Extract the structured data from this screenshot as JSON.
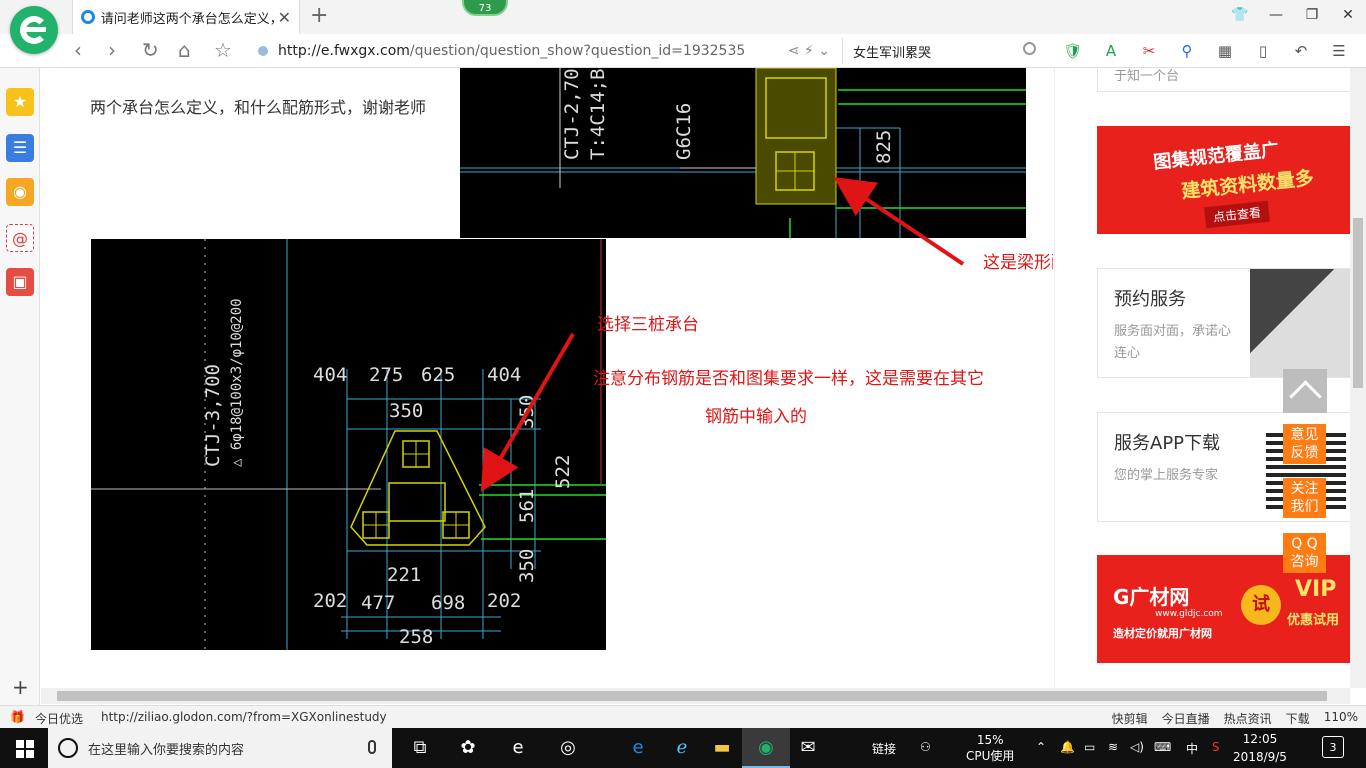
{
  "browser": {
    "tab_title": "请问老师这两个承台怎么定义，谢谢老师",
    "badge_count": "73",
    "url_host": "http://e.fwxgx.com",
    "url_path": "/question/question_show?question_id=1932535",
    "search_query": "女生军训累哭"
  },
  "question": {
    "text": "两个承台怎么定义，和什么配筋形式，谢谢老师"
  },
  "cad_top": {
    "label_ctj": "CTJ-2,70",
    "label_t": "T:4C14;B",
    "label_g": "G6C16",
    "dim_825": "825"
  },
  "cad_bottom": {
    "label_ctj": "CTJ-3,700",
    "label_rebar": "△ 6φ18@100x3/φ10@200",
    "dims": {
      "d404a": "404",
      "d275": "275",
      "d625": "625",
      "d404b": "404",
      "d350top": "350",
      "d350r": "350",
      "d522": "522",
      "d561": "561",
      "d350r2": "350",
      "d221": "221",
      "d202a": "202",
      "d477": "477",
      "d698": "698",
      "d202b": "202",
      "d258": "258"
    }
  },
  "annotations": {
    "beam": "这是梁形配筋承台",
    "three_pile": "选择三桩承台",
    "note_line1": "注意分布钢筋是否和图集要求一样，这是需要在其它",
    "note_line2": "钢筋中输入的"
  },
  "sidebar": {
    "top_partial": "于知一个台",
    "banner1": {
      "line1": "图集规范覆盖广",
      "line2": "建筑资料数量多",
      "button": "点击查看"
    },
    "card1": {
      "title": "预约服务",
      "sub": "服务面对面，承诺心连心"
    },
    "card2": {
      "title": "服务APP下载",
      "sub": "您的掌上服务专家"
    },
    "banner2": {
      "logo": "G广材网",
      "url": "www.gldjc.com",
      "tag": "造材定价就用广材网",
      "circle": "试",
      "vip": "VIP",
      "vip_sub": "优惠试用"
    }
  },
  "float_buttons": {
    "feedback": "意见\n反馈",
    "follow": "关注\n我们",
    "qq": "Q Q\n咨询"
  },
  "statusbar": {
    "today": "今日优选",
    "link": "http://ziliao.glodon.com/?from=XGXonlinestudy",
    "items": [
      "快剪辑",
      "今日直播",
      "热点资讯",
      "下载"
    ],
    "zoom": "110%"
  },
  "taskbar": {
    "search_placeholder": "在这里输入你要搜索的内容",
    "link_label": "链接",
    "cpu_percent": "15%",
    "cpu_label": "CPU使用",
    "ime": "中",
    "time": "12:05",
    "date": "2018/9/5",
    "notifications": "3"
  },
  "colors": {
    "accent_green": "#21b26b",
    "cad_yellow": "#d4d400",
    "annotation_red": "#e01414",
    "orange": "#ff7b14"
  }
}
